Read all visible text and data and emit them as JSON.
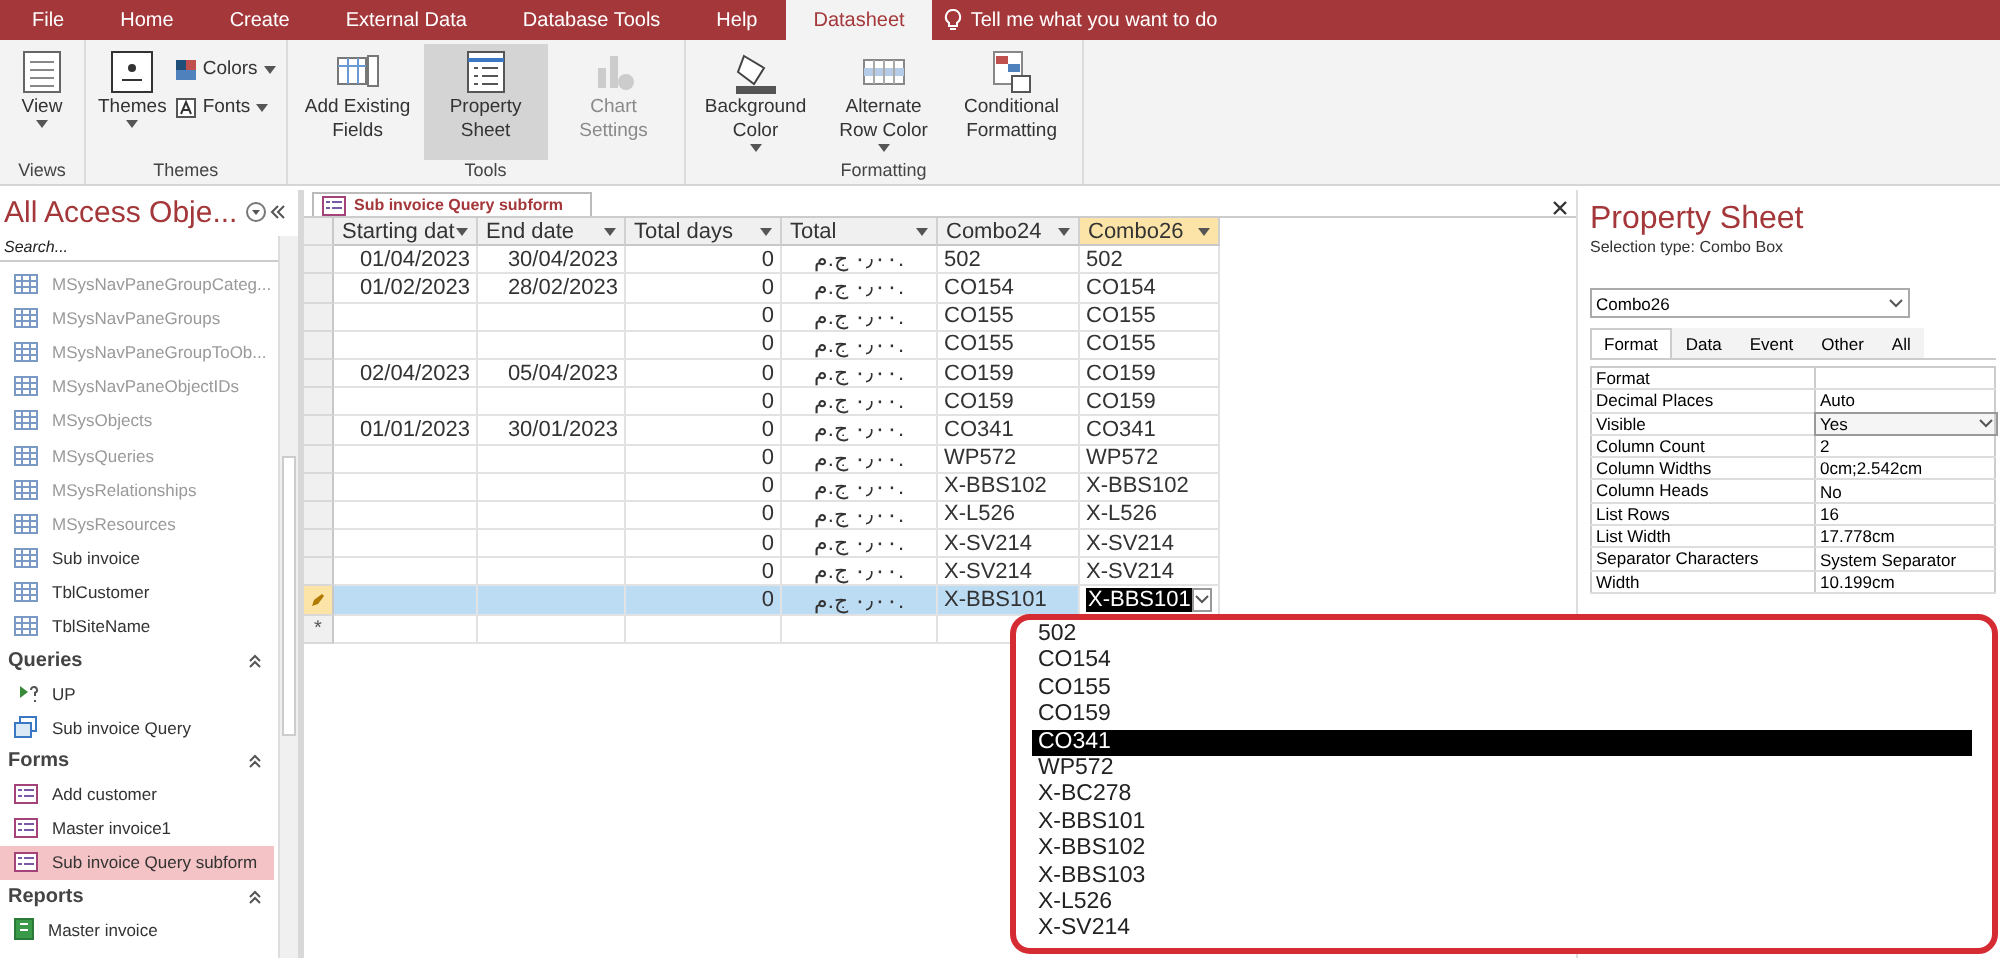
{
  "menu_tabs": [
    {
      "label": "File",
      "selected": false
    },
    {
      "label": "Home",
      "selected": false
    },
    {
      "label": "Create",
      "selected": false
    },
    {
      "label": "External Data",
      "selected": false
    },
    {
      "label": "Database Tools",
      "selected": false
    },
    {
      "label": "Help",
      "selected": false
    },
    {
      "label": "Datasheet",
      "selected": true
    }
  ],
  "tell_me": "Tell me what you want to do",
  "ribbon": {
    "groups": [
      {
        "label": "Views",
        "buttons": [
          {
            "kind": "large",
            "label": "View",
            "menu": true,
            "selected": false,
            "disabled": false
          }
        ]
      },
      {
        "label": "Themes",
        "buttons": [
          {
            "kind": "large",
            "label": "Themes",
            "menu": true,
            "selected": false,
            "disabled": false
          },
          {
            "kind": "small",
            "label": "Colors",
            "menu": true,
            "selected": false,
            "disabled": false
          },
          {
            "kind": "small",
            "label": "Fonts",
            "menu": true,
            "selected": false,
            "disabled": false
          }
        ]
      },
      {
        "label": "Tools",
        "buttons": [
          {
            "kind": "large",
            "label": "Add Existing Fields",
            "menu": false,
            "selected": false,
            "disabled": false
          },
          {
            "kind": "large",
            "label": "Property Sheet",
            "menu": false,
            "selected": true,
            "disabled": false
          },
          {
            "kind": "large",
            "label": "Chart Settings",
            "menu": false,
            "selected": false,
            "disabled": true
          }
        ]
      },
      {
        "label": "Formatting",
        "buttons": [
          {
            "kind": "large",
            "label": "Background Color",
            "menu": true,
            "selected": false,
            "disabled": false
          },
          {
            "kind": "large",
            "label": "Alternate Row Color",
            "menu": true,
            "selected": false,
            "disabled": false
          },
          {
            "kind": "large",
            "label": "Conditional Formatting",
            "menu": false,
            "selected": false,
            "disabled": false
          }
        ]
      }
    ]
  },
  "nav_pane": {
    "title": "All Access Obje...",
    "search": {
      "placeholder": "Search..."
    },
    "sections": [
      {
        "items": [
          {
            "kind": "table",
            "label": "MSysNavPaneGroupCateg...",
            "system": true,
            "selected": false
          },
          {
            "kind": "table",
            "label": "MSysNavPaneGroups",
            "system": true,
            "selected": false
          },
          {
            "kind": "table",
            "label": "MSysNavPaneGroupToOb...",
            "system": true,
            "selected": false
          },
          {
            "kind": "table",
            "label": "MSysNavPaneObjectIDs",
            "system": true,
            "selected": false
          },
          {
            "kind": "table",
            "label": "MSysObjects",
            "system": true,
            "selected": false
          },
          {
            "kind": "table",
            "label": "MSysQueries",
            "system": true,
            "selected": false
          },
          {
            "kind": "table",
            "label": "MSysRelationships",
            "system": true,
            "selected": false
          },
          {
            "kind": "table",
            "label": "MSysResources",
            "system": true,
            "selected": false
          },
          {
            "kind": "table",
            "label": "Sub invoice",
            "system": false,
            "selected": false
          },
          {
            "kind": "table",
            "label": "TblCustomer",
            "system": false,
            "selected": false
          },
          {
            "kind": "table",
            "label": "TblSiteName",
            "system": false,
            "selected": false
          }
        ]
      },
      {
        "label": "Queries",
        "items": [
          {
            "kind": "update_query",
            "label": "UP",
            "system": false,
            "selected": false
          },
          {
            "kind": "query",
            "label": "Sub invoice Query",
            "system": false,
            "selected": false
          }
        ]
      },
      {
        "label": "Forms",
        "items": [
          {
            "kind": "form",
            "label": "Add customer",
            "system": false,
            "selected": false
          },
          {
            "kind": "form",
            "label": "Master invoice1",
            "system": false,
            "selected": false
          },
          {
            "kind": "form",
            "label": "Sub invoice Query subform",
            "system": false,
            "selected": true
          }
        ]
      },
      {
        "label": "Reports",
        "items": [
          {
            "kind": "report",
            "label": "Master invoice",
            "system": false,
            "selected": false
          }
        ]
      }
    ]
  },
  "document_tab": {
    "title": "Sub invoice Query subform"
  },
  "datasheet": {
    "columns": [
      {
        "label": "Starting dat",
        "selected": false
      },
      {
        "label": "End date",
        "selected": false
      },
      {
        "label": "Total days",
        "selected": false
      },
      {
        "label": "Total",
        "selected": false
      },
      {
        "label": "Combo24",
        "selected": false
      },
      {
        "label": "Combo26",
        "selected": true
      }
    ],
    "rows": [
      {
        "cells": [
          "01/04/2023",
          "30/04/2023",
          "0",
          "٠٫٠٠ ج.م.",
          "502",
          "502"
        ],
        "editing": false
      },
      {
        "cells": [
          "01/02/2023",
          "28/02/2023",
          "0",
          "٠٫٠٠ ج.م.",
          "CO154",
          "CO154"
        ],
        "editing": false
      },
      {
        "cells": [
          "",
          "",
          "0",
          "٠٫٠٠ ج.م.",
          "CO155",
          "CO155"
        ],
        "editing": false
      },
      {
        "cells": [
          "",
          "",
          "0",
          "٠٫٠٠ ج.م.",
          "CO155",
          "CO155"
        ],
        "editing": false
      },
      {
        "cells": [
          "02/04/2023",
          "05/04/2023",
          "0",
          "٠٫٠٠ ج.م.",
          "CO159",
          "CO159"
        ],
        "editing": false
      },
      {
        "cells": [
          "",
          "",
          "0",
          "٠٫٠٠ ج.م.",
          "CO159",
          "CO159"
        ],
        "editing": false
      },
      {
        "cells": [
          "01/01/2023",
          "30/01/2023",
          "0",
          "٠٫٠٠ ج.م.",
          "CO341",
          "CO341"
        ],
        "editing": false
      },
      {
        "cells": [
          "",
          "",
          "0",
          "٠٫٠٠ ج.م.",
          "WP572",
          "WP572"
        ],
        "editing": false
      },
      {
        "cells": [
          "",
          "",
          "0",
          "٠٫٠٠ ج.م.",
          "X-BBS102",
          "X-BBS102"
        ],
        "editing": false
      },
      {
        "cells": [
          "",
          "",
          "0",
          "٠٫٠٠ ج.م.",
          "X-L526",
          "X-L526"
        ],
        "editing": false
      },
      {
        "cells": [
          "",
          "",
          "0",
          "٠٫٠٠ ج.م.",
          "X-SV214",
          "X-SV214"
        ],
        "editing": false
      },
      {
        "cells": [
          "",
          "",
          "0",
          "٠٫٠٠ ج.م.",
          "X-SV214",
          "X-SV214"
        ],
        "editing": false
      },
      {
        "cells": [
          "",
          "",
          "0",
          "٠٫٠٠ ج.م.",
          "X-BBS101",
          "X-BBS101"
        ],
        "editing": true
      }
    ],
    "new_row_marker": "*",
    "dropdown": {
      "items": [
        {
          "label": "502",
          "selected": false
        },
        {
          "label": "CO154",
          "selected": false
        },
        {
          "label": "CO155",
          "selected": false
        },
        {
          "label": "CO159",
          "selected": false
        },
        {
          "label": "CO341",
          "selected": true
        },
        {
          "label": "WP572",
          "selected": false
        },
        {
          "label": "X-BC278",
          "selected": false
        },
        {
          "label": "X-BBS101",
          "selected": false
        },
        {
          "label": "X-BBS102",
          "selected": false
        },
        {
          "label": "X-BBS103",
          "selected": false
        },
        {
          "label": "X-L526",
          "selected": false
        },
        {
          "label": "X-SV214",
          "selected": false
        }
      ]
    }
  },
  "property_sheet": {
    "title": "Property Sheet",
    "selection_label": "Selection type:",
    "selection_type": "Combo Box",
    "object": "Combo26",
    "tabs": [
      {
        "label": "Format",
        "selected": true
      },
      {
        "label": "Data",
        "selected": false
      },
      {
        "label": "Event",
        "selected": false
      },
      {
        "label": "Other",
        "selected": false
      },
      {
        "label": "All",
        "selected": false
      }
    ],
    "rows": [
      {
        "name": "Format",
        "value": "",
        "selected": false
      },
      {
        "name": "Decimal Places",
        "value": "Auto",
        "selected": false
      },
      {
        "name": "Visible",
        "value": "Yes",
        "selected": true
      },
      {
        "name": "Column Count",
        "value": "2",
        "selected": false
      },
      {
        "name": "Column Widths",
        "value": "0cm;2.542cm",
        "selected": false
      },
      {
        "name": "Column Heads",
        "value": "No",
        "selected": false
      },
      {
        "name": "List Rows",
        "value": "16",
        "selected": false
      },
      {
        "name": "List Width",
        "value": "17.778cm",
        "selected": false
      },
      {
        "name": "Separator Characters",
        "value": "System Separator",
        "selected": false
      },
      {
        "name": "Width",
        "value": "10.199cm",
        "selected": false
      }
    ]
  }
}
